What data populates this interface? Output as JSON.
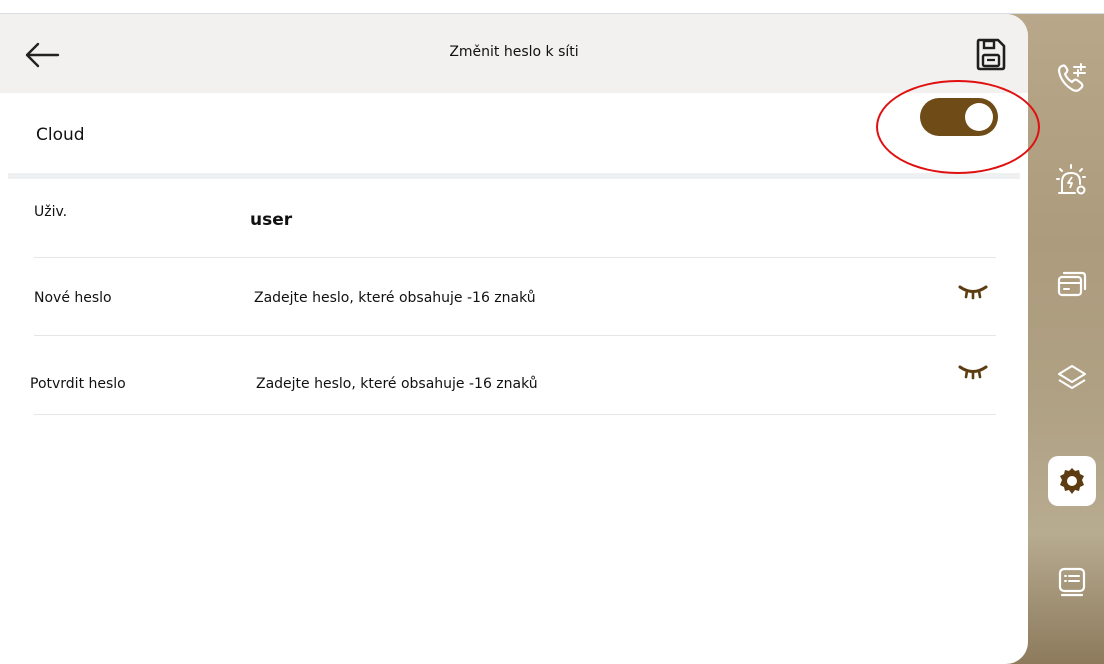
{
  "header": {
    "title": "Změnit heslo k síti"
  },
  "cloud": {
    "label": "Cloud",
    "enabled": true
  },
  "fields": {
    "user": {
      "label": "Uživ.",
      "value": "user"
    },
    "new_password": {
      "label": "Nové heslo",
      "placeholder": "Zadejte heslo, které obsahuje -16 znaků"
    },
    "confirm_password": {
      "label": "Potvrdit heslo",
      "placeholder": "Zadejte heslo, které obsahuje -16 znaků"
    }
  },
  "icons": {
    "back": "arrow-left-icon",
    "save": "floppy-disk-icon",
    "eye": "eye-closed-icon",
    "sidebar": [
      "phone-settings-icon",
      "alarm-icon",
      "card-icon",
      "layers-icon",
      "settings-icon",
      "list-icon"
    ]
  },
  "colors": {
    "accent": "#6e4b17",
    "icon_brown": "#5c3d12",
    "highlight_ring": "#e01010",
    "header_bg": "#f2f1ef",
    "sidebar_bg": "#b0a184"
  }
}
